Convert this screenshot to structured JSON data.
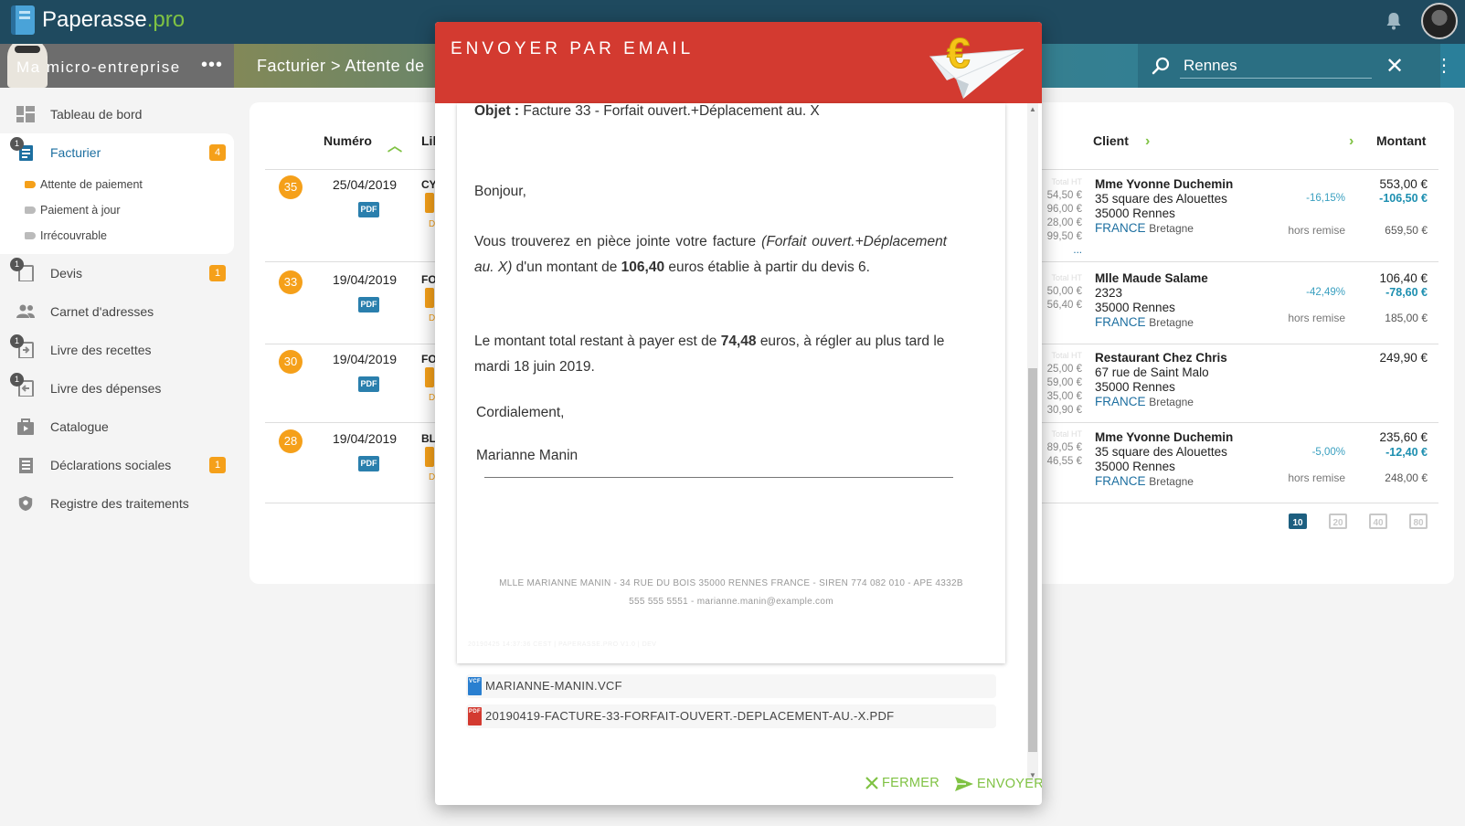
{
  "app": {
    "brand_main": "Paperasse",
    "brand_suffix": ".pro",
    "org_name": "Ma micro-entreprise",
    "org_menu": "•••",
    "breadcrumb": "Facturier > Attente de",
    "search_value": "Rennes",
    "search_clear": "✕",
    "menu_dots": "⋮"
  },
  "sidebar": {
    "items": [
      {
        "label": "Tableau de bord",
        "icon": "dashboard-icon"
      },
      {
        "label": "Facturier",
        "icon": "invoice-icon",
        "corner": "1",
        "count": "4"
      },
      {
        "label": "Devis",
        "icon": "quote-icon",
        "corner": "1",
        "count": "1"
      },
      {
        "label": "Carnet d'adresses",
        "icon": "people-icon"
      },
      {
        "label": "Livre des recettes",
        "icon": "income-book-icon",
        "corner": "1"
      },
      {
        "label": "Livre des dépenses",
        "icon": "expense-book-icon",
        "corner": "1"
      },
      {
        "label": "Catalogue",
        "icon": "catalog-icon"
      },
      {
        "label": "Déclarations sociales",
        "icon": "declarations-icon",
        "count": "1"
      },
      {
        "label": "Registre des traitements",
        "icon": "shield-icon"
      }
    ],
    "sub_items": [
      "Attente de paiement",
      "Paiement à jour",
      "Irrécouvrable"
    ]
  },
  "table": {
    "headers": {
      "numero": "Numéro",
      "libelle": "Lib",
      "client": "Client",
      "montant": "Montant"
    },
    "pdf_label": "PDF",
    "hors_remise": "hors remise",
    "rows": [
      {
        "num": "35",
        "date": "25/04/2019",
        "lib": "CY",
        "lib_d": "D",
        "hidden": [
          "Total HT",
          "54,50 €",
          "96,00 €",
          "28,00 €",
          "99,50 €",
          "..."
        ],
        "client_name": "Mme Yvonne Duchemin",
        "addr1": "35 square des Alouettes",
        "addr2": "35000 Rennes",
        "country": "FRANCE",
        "region": "Bretagne",
        "pct": "-16,15%",
        "amount": "553,00 €",
        "discount": "-106,50 €",
        "original": "659,50 €"
      },
      {
        "num": "33",
        "date": "19/04/2019",
        "lib": "FO",
        "lib_d": "D",
        "hidden": [
          "Total HT",
          "50,00 €",
          "56,40 €"
        ],
        "client_name": "Mlle Maude Salame",
        "addr1": "2323",
        "addr2": "35000 Rennes",
        "country": "FRANCE",
        "region": "Bretagne",
        "pct": "-42,49%",
        "amount": "106,40 €",
        "discount": "-78,60 €",
        "original": "185,00 €"
      },
      {
        "num": "30",
        "date": "19/04/2019",
        "lib": "FO",
        "lib_d": "D",
        "hidden": [
          "Total HT",
          "25,00 €",
          "59,00 €",
          "35,00 €",
          "30,90 €"
        ],
        "client_name": "Restaurant Chez Chris",
        "addr1": "67 rue de Saint Malo",
        "addr2": "35000 Rennes",
        "country": "FRANCE",
        "region": "Bretagne",
        "pct": "",
        "amount": "249,90 €",
        "discount": "",
        "original": ""
      },
      {
        "num": "28",
        "date": "19/04/2019",
        "lib": "BL",
        "lib_d": "D",
        "hidden": [
          "Total HT",
          "89,05 €",
          "46,55 €"
        ],
        "client_name": "Mme Yvonne Duchemin",
        "addr1": "35 square des Alouettes",
        "addr2": "35000 Rennes",
        "country": "FRANCE",
        "region": "Bretagne",
        "pct": "-5,00%",
        "amount": "235,60 €",
        "discount": "-12,40 €",
        "original": "248,00 €"
      }
    ],
    "pager": [
      "10",
      "20",
      "40",
      "80"
    ],
    "pager_active": "10"
  },
  "modal": {
    "title": "ENVOYER PAR EMAIL",
    "subject_label": "Objet :",
    "subject_value": "Facture 33 - Forfait ouvert.+Déplacement au. X",
    "greeting": "Bonjour,",
    "p1_a": "Vous trouverez en pièce jointe votre facture",
    "p1_italic": "(Forfait ouvert.+Déplacement au. X)",
    "p1_b": "d'un montant de",
    "p1_amount": "106,40",
    "p1_c": "euros établie à partir du devis 6.",
    "p2_a": "Le montant total restant à payer est de",
    "p2_amount": "74,48",
    "p2_b": "euros, à régler au plus tard le mardi 18 juin 2019.",
    "closing": "Cordialement,",
    "signature": "Marianne Manin",
    "footer1": "MLLE MARIANNE MANIN - 34 RUE DU BOIS 35000 RENNES FRANCE - SIREN 774 082 010 - APE 4332B",
    "footer2": "555 555 5551 - marianne.manin@example.com",
    "faint_line": "20190425 14:37:36 CEST | PAPERASSE.PRO V1.0 | DEV",
    "attachments": [
      {
        "name": "MARIANNE-MANIN.VCF",
        "type": "VCF",
        "color": "#2a7fd0"
      },
      {
        "name": "20190419-FACTURE-33-FORFAIT-OUVERT.-DEPLACEMENT-AU.-X.PDF",
        "type": "PDF",
        "color": "#d33a30"
      }
    ],
    "close_label": "FERMER",
    "send_label": "ENVOYER"
  },
  "colors": {
    "accent": "#7fc243",
    "header_red": "#d33a30",
    "badge_orange": "#f5a01a",
    "topbar": "#1f4a5f"
  }
}
